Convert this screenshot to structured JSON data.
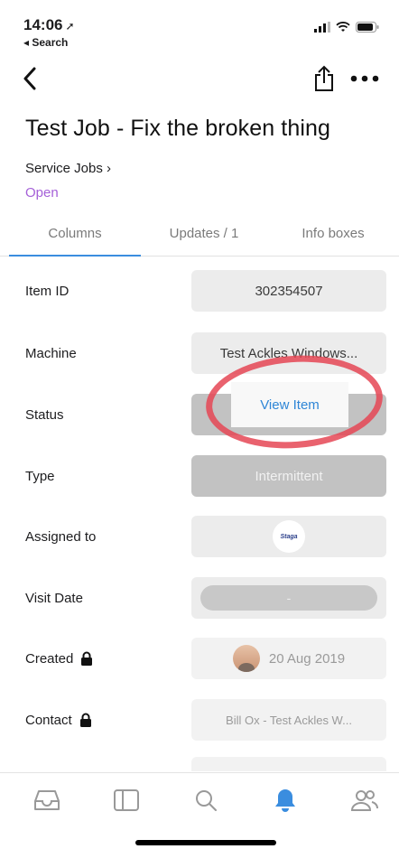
{
  "status_bar": {
    "time": "14:06",
    "back_app": "◂ Search"
  },
  "page": {
    "title": "Test Job - Fix the broken thing",
    "breadcrumb": "Service Jobs ›",
    "status": "Open"
  },
  "tabs": [
    {
      "label": "Columns",
      "active": true
    },
    {
      "label": "Updates / 1",
      "active": false
    },
    {
      "label": "Info boxes",
      "active": false
    }
  ],
  "fields": {
    "item_id": {
      "label": "Item ID",
      "value": "302354507"
    },
    "machine": {
      "label": "Machine",
      "value": "Test Ackles Windows..."
    },
    "status": {
      "label": "Status",
      "value": "View Item"
    },
    "type": {
      "label": "Type",
      "value": "Intermittent"
    },
    "assigned_to": {
      "label": "Assigned to",
      "value": "Staga"
    },
    "visit_date": {
      "label": "Visit Date",
      "value": "-"
    },
    "created": {
      "label": "Created",
      "value": "20 Aug 2019"
    },
    "contact": {
      "label": "Contact",
      "value": "Bill Ox - Test Ackles W..."
    }
  },
  "bottom_nav": [
    {
      "icon": "inbox-icon"
    },
    {
      "icon": "sidebar-panel-icon"
    },
    {
      "icon": "search-icon"
    },
    {
      "icon": "bell-icon",
      "active": true
    },
    {
      "icon": "people-icon"
    }
  ],
  "colors": {
    "accent": "#3a8ddf",
    "status_open": "#a560d8",
    "annotation_circle": "#e54655"
  }
}
